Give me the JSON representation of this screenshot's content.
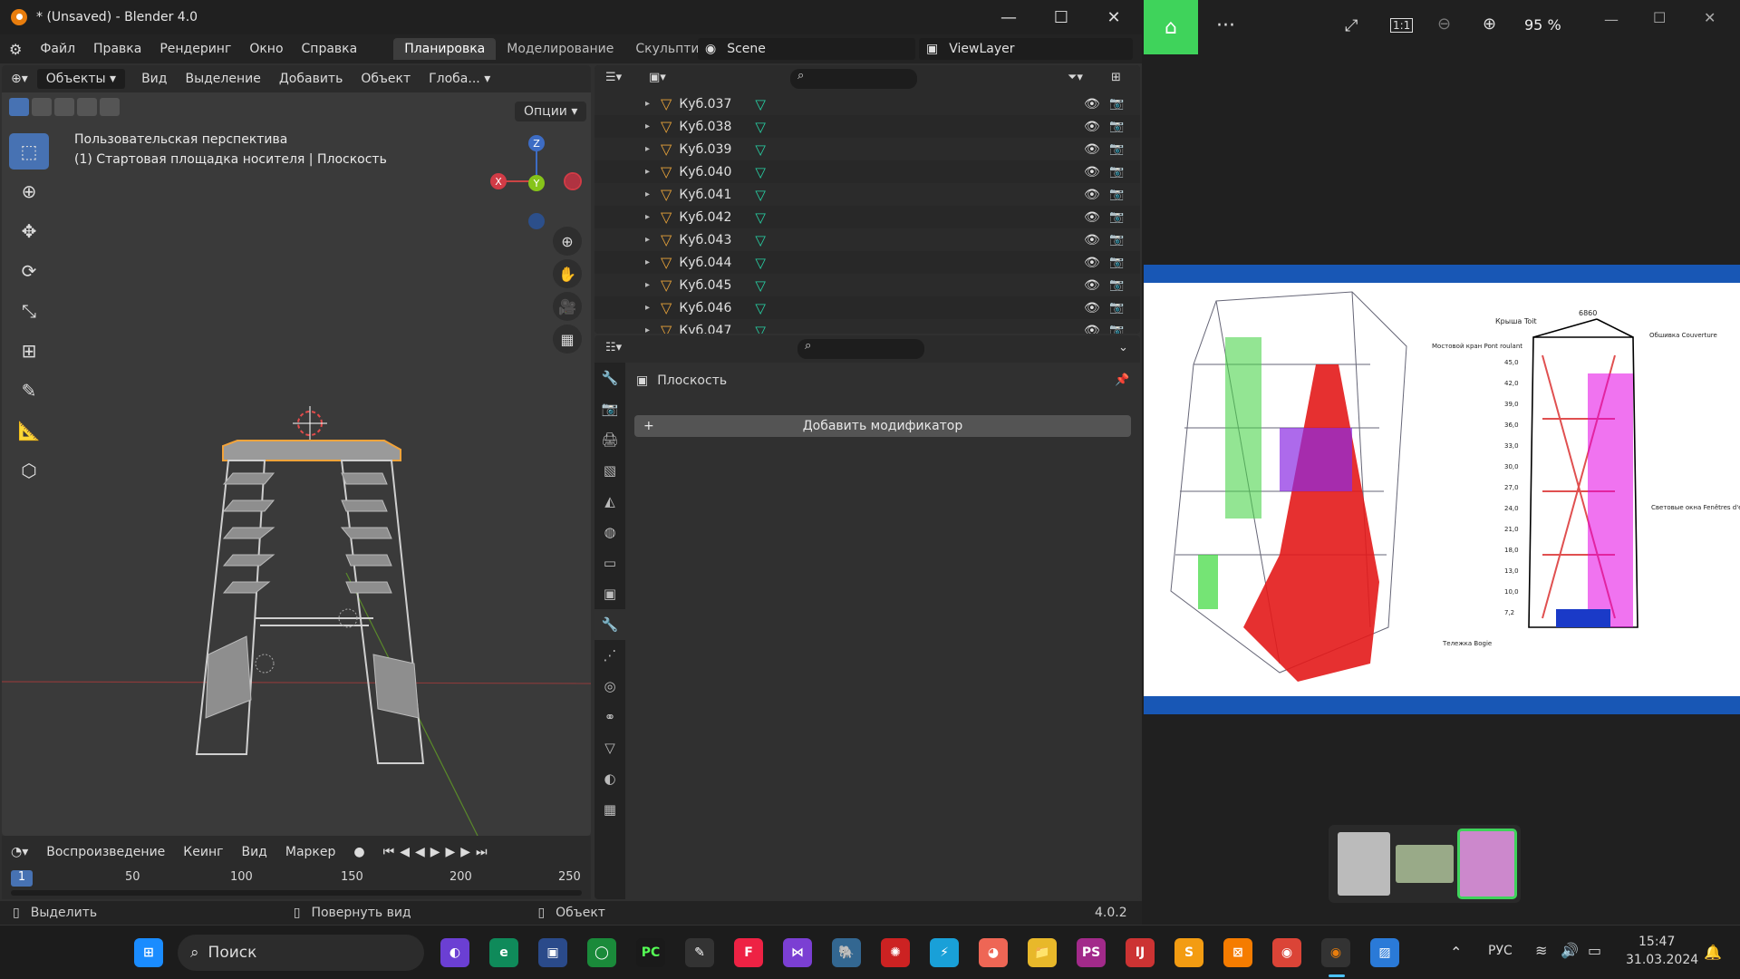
{
  "blender": {
    "window_title": "* (Unsaved) - Blender 4.0",
    "win_controls": {
      "minimize": "—",
      "maximize": "☐",
      "close": "✕"
    },
    "menus": [
      "Файл",
      "Правка",
      "Рендеринг",
      "Окно",
      "Справка"
    ],
    "workspace_tabs": [
      "Планировка",
      "Моделирование",
      "Скульптинг"
    ],
    "active_tab": "Планировка",
    "scene": "Scene",
    "view_layer": "ViewLayer",
    "viewport_header": {
      "mode": "Объекты",
      "menus": [
        "Вид",
        "Выделение",
        "Добавить",
        "Объект"
      ],
      "transform": "Глоба...",
      "options": "Опции"
    },
    "viewport": {
      "perspective_label": "Пользовательская перспектива",
      "object_label": "(1) Стартовая площадка носителя | Плоскость",
      "gizmo": {
        "z": "Z",
        "y": "Y",
        "x": "X"
      }
    },
    "timeline": {
      "menus": [
        "Воспроизведение",
        "Кеинг",
        "Вид",
        "Маркер"
      ],
      "current_frame": "1",
      "ticks": [
        "50",
        "100",
        "150",
        "200",
        "250"
      ]
    },
    "statusbar": {
      "items": [
        "Выделить",
        "Повернуть вид",
        "Объект"
      ],
      "version": "4.0.2"
    },
    "outliner": {
      "items": [
        "Куб.037",
        "Куб.038",
        "Куб.039",
        "Куб.040",
        "Куб.041",
        "Куб.042",
        "Куб.043",
        "Куб.044",
        "Куб.045",
        "Куб.046",
        "Куб.047"
      ]
    },
    "properties": {
      "object_name": "Плоскость",
      "add_modifier": "Добавить модификатор"
    }
  },
  "photos": {
    "zoom": "95 %",
    "figure_labels": {
      "roof": "Крыша Toit",
      "dimension": "6860",
      "crane": "Мостовой кран Pont roulant",
      "cladding": "Обшивка Couverture",
      "trolley": "Тележка Bogie",
      "lights": "Световые окна Fenêtres d'éclairage",
      "heights": [
        "45,0",
        "42,0",
        "39,0",
        "36,0",
        "33,0",
        "30,0",
        "27,0",
        "24,0",
        "21,0",
        "18,0",
        "13,0",
        "10,0",
        "7,2"
      ]
    }
  },
  "taskbar": {
    "search": "Поиск",
    "lang": "РУС",
    "time": "15:47",
    "date": "31.03.2024"
  },
  "colors": {
    "blender_accent": "#4772b3",
    "selection_orange": "#e8a33a",
    "photos_home": "#3fd35b",
    "figure_blue": "#1857b5"
  }
}
